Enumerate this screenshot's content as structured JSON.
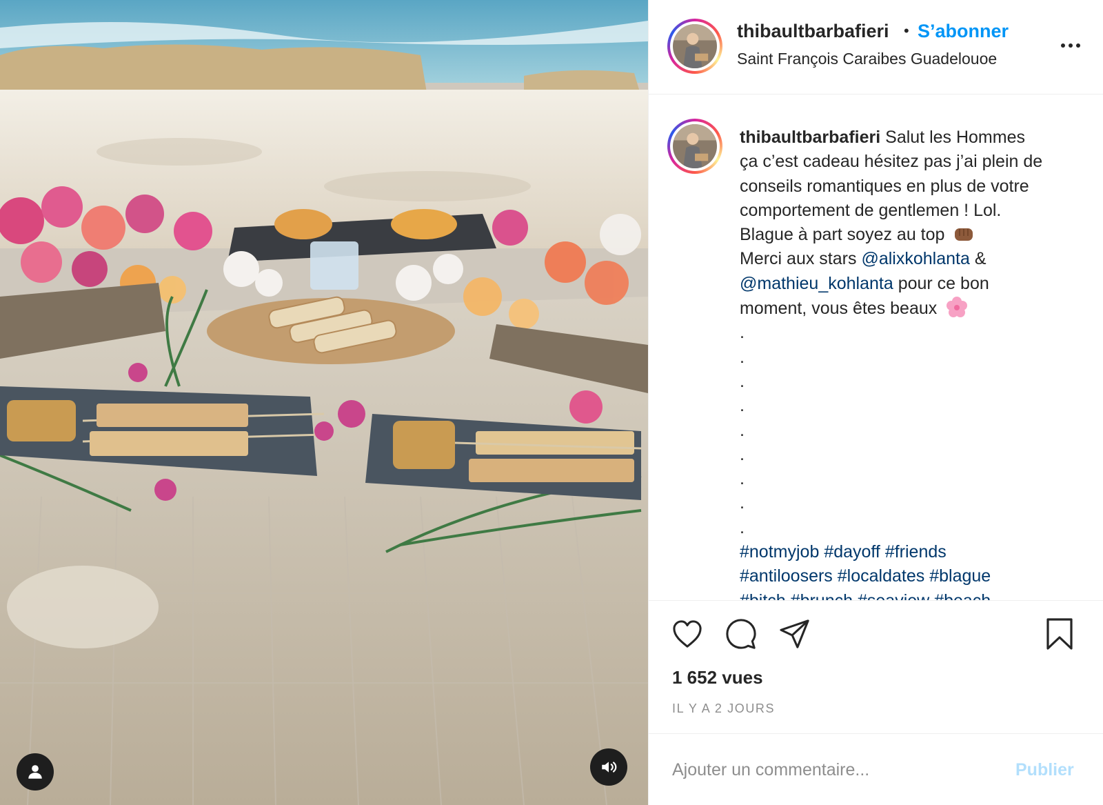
{
  "post": {
    "header": {
      "username": "thibaultbarbafieri",
      "separator": "•",
      "follow_label": "S’abonner",
      "location": "Saint François Caraibes Guadelouoe",
      "more_icon": "more-horizontal-icon"
    },
    "caption": {
      "username": "thibaultbarbafieri",
      "line1": "Salut les Hommes",
      "line2": "ça c’est cadeau hésitez pas j’ai plein de",
      "line3": "conseils romantiques en plus de votre",
      "line4": "comportement de gentlemen ! Lol.",
      "line5": "Blague à part soyez au top",
      "line6_prefix": "Merci aux stars",
      "mention1": "@alixkohlanta",
      "line6_suffix": "&",
      "mention2": "@mathieu_kohlanta",
      "line7_suffix": "pour ce bon",
      "line8": "moment, vous êtes beaux",
      "dots": [
        ".",
        ".",
        ".",
        ".",
        ".",
        ".",
        ".",
        ".",
        "."
      ],
      "hashtags_row1": [
        "#notmyjob",
        "#dayoff",
        "#friends"
      ],
      "hashtags_row2": [
        "#antiloosers",
        "#localdates",
        "#blague"
      ],
      "hashtags_row3": [
        "#bitch",
        "#brunch",
        "#seaview",
        "#beach"
      ]
    },
    "actions": {
      "like_icon": "heart-icon",
      "comment_icon": "comment-icon",
      "share_icon": "share-icon",
      "save_icon": "bookmark-icon"
    },
    "views": "1 652 vues",
    "timestamp": "IL Y A 2 JOURS",
    "comment": {
      "placeholder": "Ajouter un commentaire...",
      "publish_label": "Publier"
    }
  },
  "media": {
    "user_tags_icon": "user-icon",
    "sound_icon": "volume-icon"
  },
  "colors": {
    "link": "#0095f6",
    "mention": "#00376b",
    "publish_disabled": "#b2dffc",
    "muted": "#8e8e8e"
  }
}
